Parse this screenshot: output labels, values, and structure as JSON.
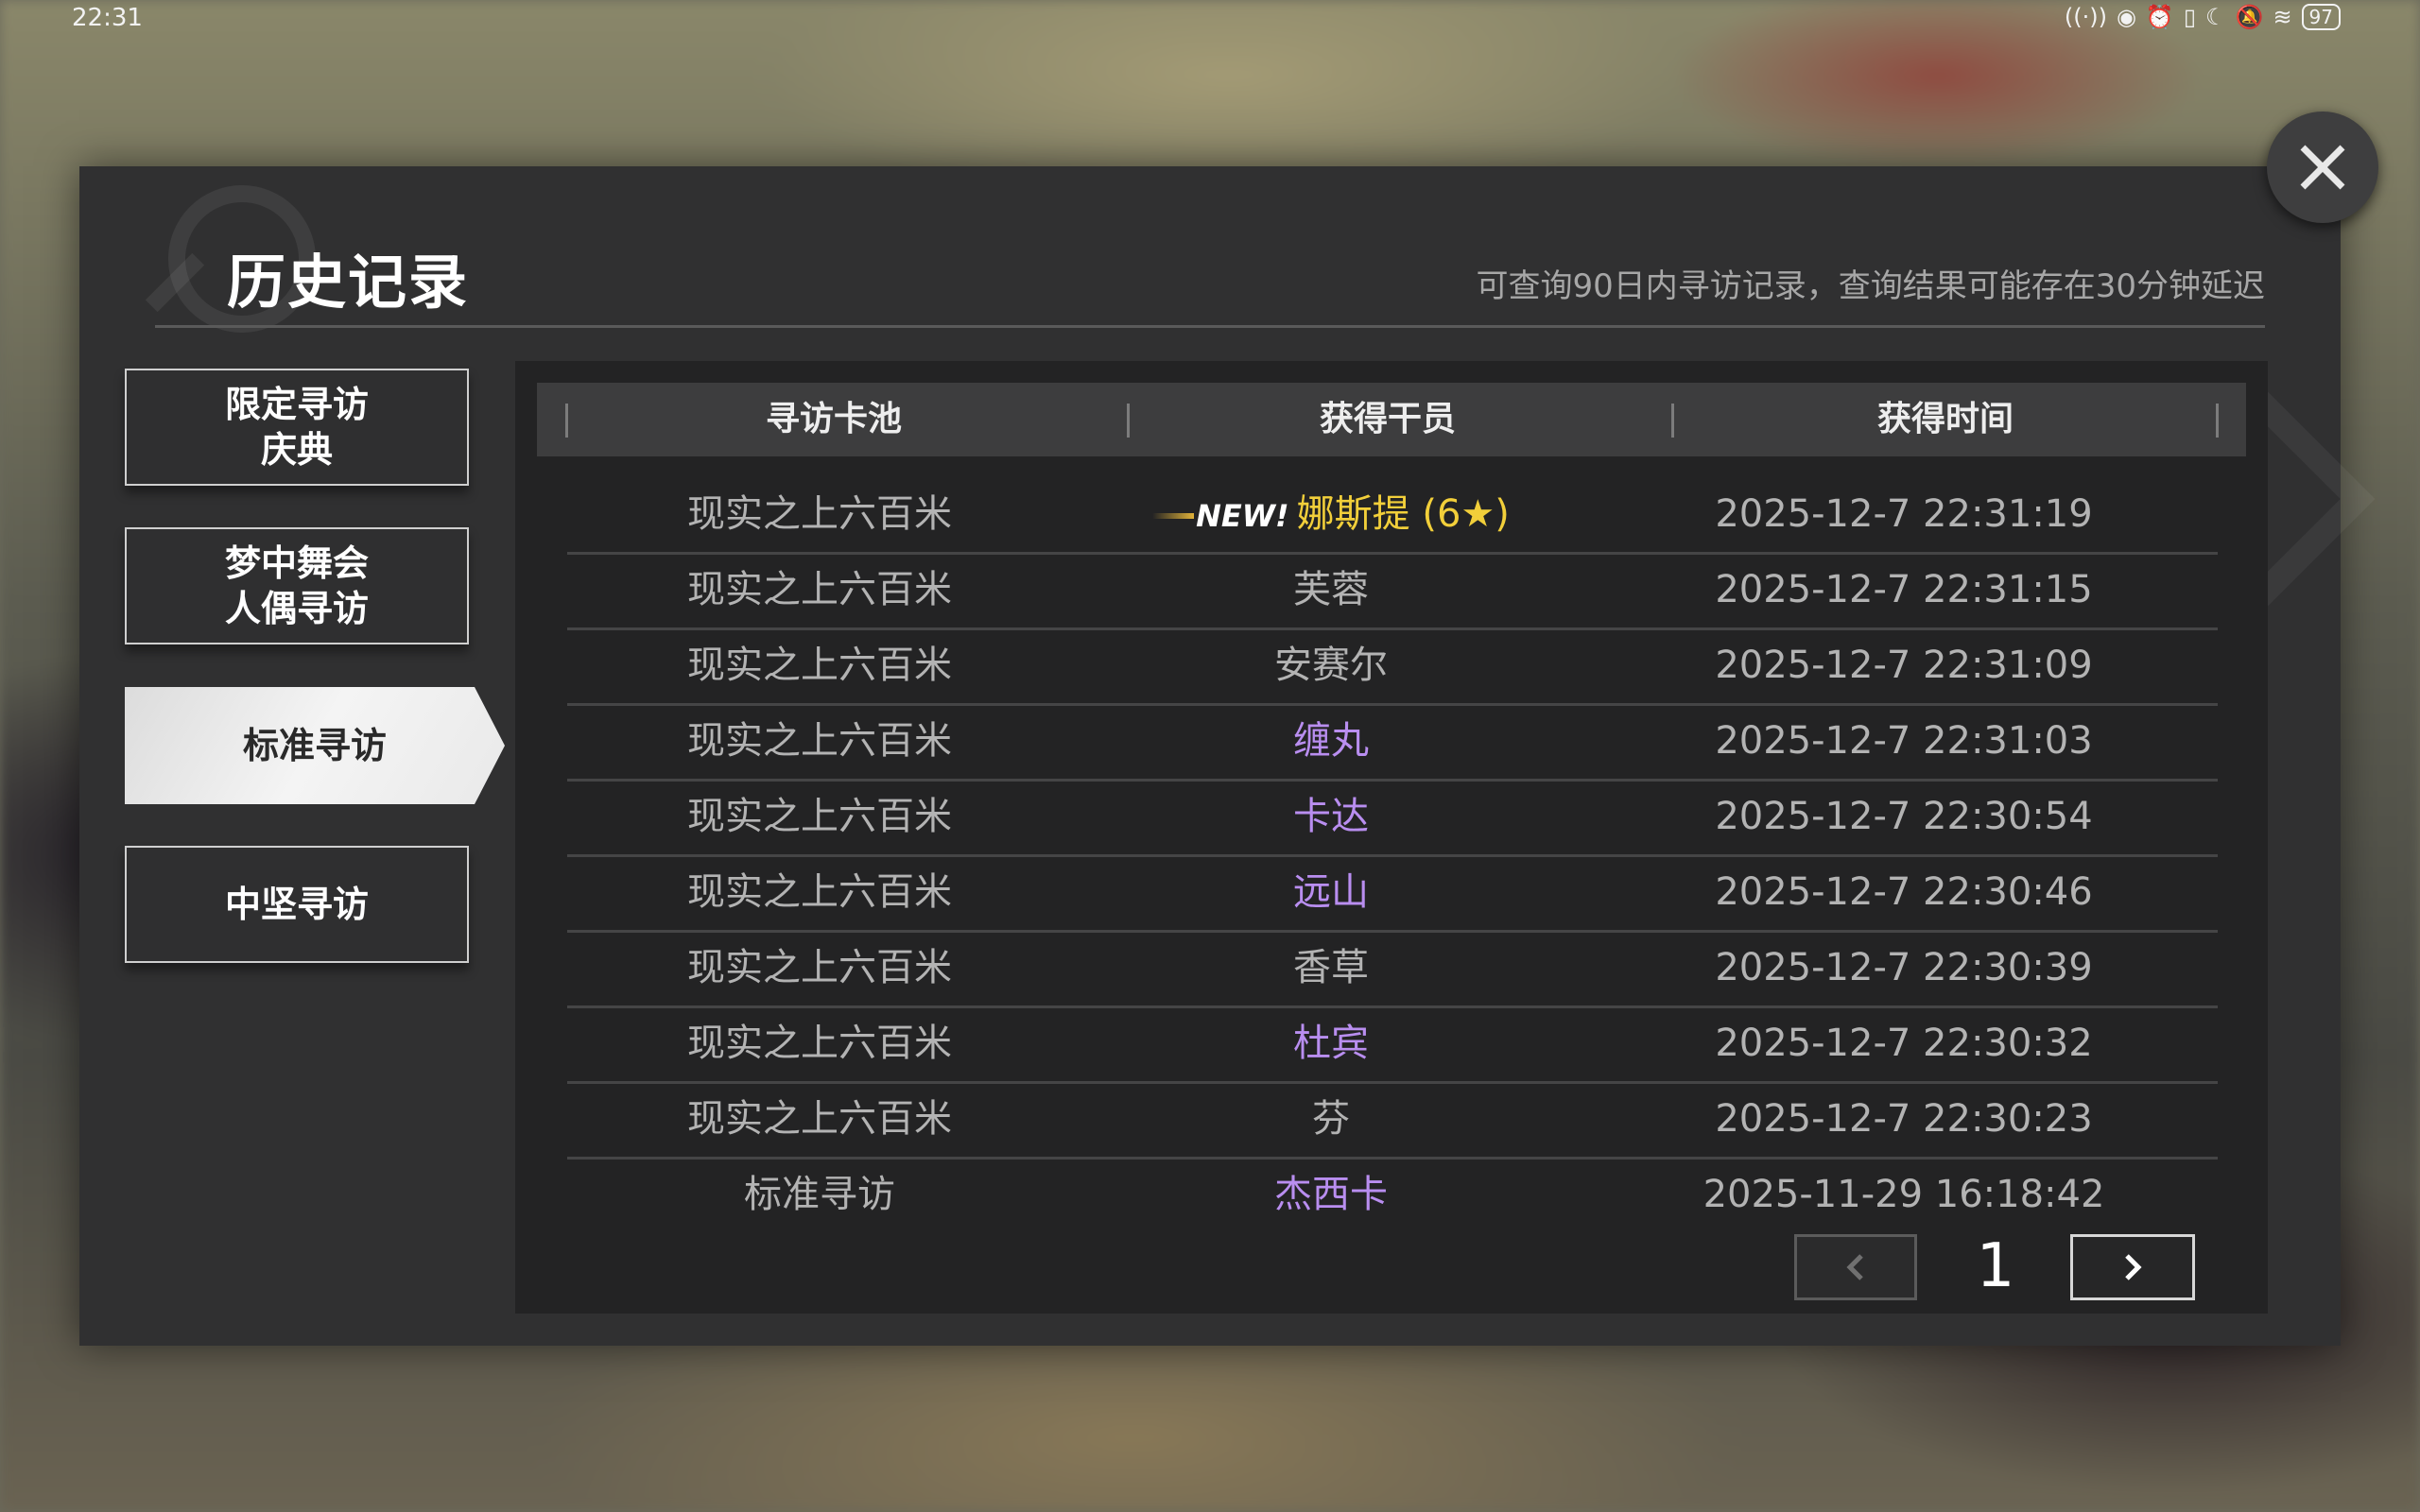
{
  "status": {
    "time": "22:31",
    "battery": "97"
  },
  "dialog": {
    "title": "历史记录",
    "subtitle": "可查询90日内寻访记录，查询结果可能存在30分钟延迟"
  },
  "sidebar": {
    "items": [
      {
        "label": "限定寻访\n庆典",
        "active": false
      },
      {
        "label": "梦中舞会\n人偶寻访",
        "active": false
      },
      {
        "label": "标准寻访",
        "active": true
      },
      {
        "label": "中坚寻访",
        "active": false
      }
    ]
  },
  "table": {
    "headers": [
      "寻访卡池",
      "获得干员",
      "获得时间"
    ],
    "new_badge": "NEW!",
    "rows": [
      {
        "pool": "现实之上六百米",
        "operator": "娜斯提 (6★)",
        "time": "2025-12-7 22:31:19",
        "rarity": "gold",
        "is_new": true
      },
      {
        "pool": "现实之上六百米",
        "operator": "芙蓉",
        "time": "2025-12-7 22:31:15",
        "rarity": "white",
        "is_new": false
      },
      {
        "pool": "现实之上六百米",
        "operator": "安赛尔",
        "time": "2025-12-7 22:31:09",
        "rarity": "white",
        "is_new": false
      },
      {
        "pool": "现实之上六百米",
        "operator": "缠丸",
        "time": "2025-12-7 22:31:03",
        "rarity": "purple",
        "is_new": false
      },
      {
        "pool": "现实之上六百米",
        "operator": "卡达",
        "time": "2025-12-7 22:30:54",
        "rarity": "purple",
        "is_new": false
      },
      {
        "pool": "现实之上六百米",
        "operator": "远山",
        "time": "2025-12-7 22:30:46",
        "rarity": "purple",
        "is_new": false
      },
      {
        "pool": "现实之上六百米",
        "operator": "香草",
        "time": "2025-12-7 22:30:39",
        "rarity": "white",
        "is_new": false
      },
      {
        "pool": "现实之上六百米",
        "operator": "杜宾",
        "time": "2025-12-7 22:30:32",
        "rarity": "purple",
        "is_new": false
      },
      {
        "pool": "现实之上六百米",
        "operator": "芬",
        "time": "2025-12-7 22:30:23",
        "rarity": "white",
        "is_new": false
      },
      {
        "pool": "标准寻访",
        "operator": "杰西卡",
        "time": "2025-11-29 16:18:42",
        "rarity": "purple",
        "is_new": false
      }
    ]
  },
  "pagination": {
    "current_page": "1",
    "prev_icon": "chevron-left-icon",
    "next_icon": "chevron-right-icon"
  },
  "colors": {
    "gold": "#f2cf3a",
    "purple": "#b98ef0",
    "white": "#b3b3b3"
  }
}
